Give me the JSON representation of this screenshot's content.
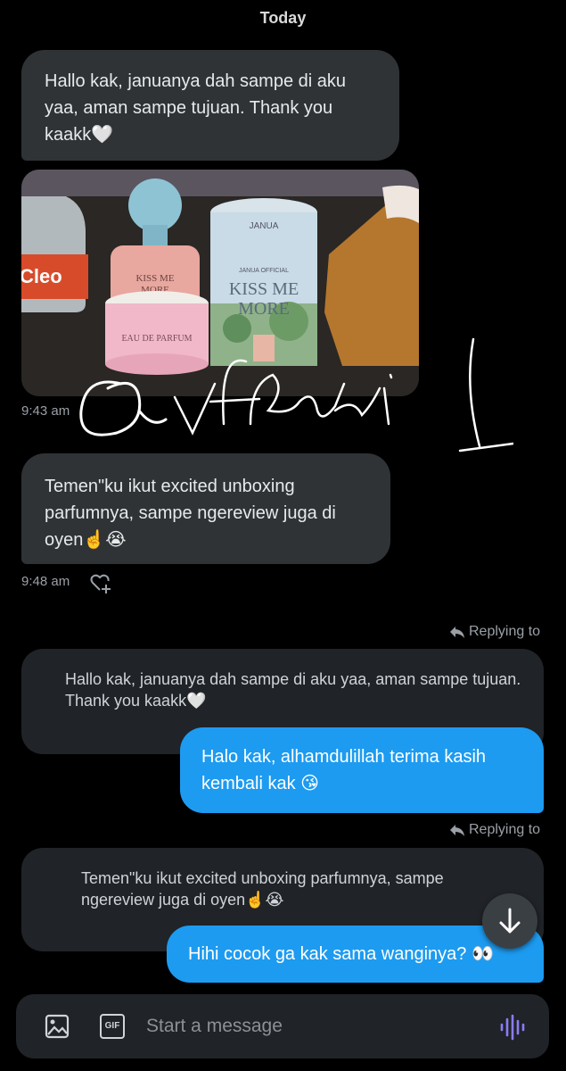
{
  "date_header": "Today",
  "messages": [
    {
      "text": "Hallo kak, januanya dah sampe di aku yaa, aman sampe tujuan. Thank you kaakk🤍"
    },
    {
      "time": "9:43 am"
    },
    {
      "text": "Temen\"ku ikut excited unboxing parfumnya, sampe ngereview juga di oyen☝️😭",
      "time": "9:48 am"
    }
  ],
  "photo": {
    "bottle_label": "Cleo",
    "tube_brand": "JANUA",
    "tube_line": "JANUA OFFICIAL",
    "tube_title_1": "KISS ME",
    "tube_title_2": "MORE",
    "bottle_title_1": "KISS ME",
    "bottle_title_2": "MORE",
    "box_text": "EAU DE PARFUM"
  },
  "watermark": "@vfbalsi",
  "replies": [
    {
      "replying_to_label": "Replying to",
      "quoted": "Hallo kak, januanya dah sampe di aku yaa, aman sampe tujuan. Thank you kaakk🤍",
      "reply": "Halo kak, alhamdulillah terima kasih kembali kak 😘"
    },
    {
      "replying_to_label": "Replying to",
      "quoted": "Temen\"ku ikut excited unboxing parfumnya, sampe ngereview juga di oyen☝️😭",
      "reply": "Hihi cocok ga kak sama wanginya? 👀"
    }
  ],
  "composer": {
    "placeholder": "Start a message",
    "gif_label": "GIF"
  },
  "icons": {
    "reply": "reply-arrow-icon",
    "heart": "heart-plus-icon",
    "image": "image-icon",
    "gif": "gif-icon",
    "voice": "voice-wave-icon",
    "scroll": "arrow-down-icon"
  },
  "colors": {
    "accent": "#1d9bf0",
    "incoming_bubble": "#2f3336",
    "background": "#000000"
  }
}
